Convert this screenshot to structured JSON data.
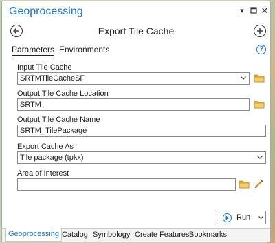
{
  "pane": {
    "title": "Geoprocessing"
  },
  "tool": {
    "title": "Export Tile Cache"
  },
  "tabs": {
    "parameters": "Parameters",
    "environments": "Environments"
  },
  "help": {
    "glyph": "?"
  },
  "fields": [
    {
      "label": "Input Tile Cache",
      "value": "SRTMTileCacheSF"
    },
    {
      "label": "Output Tile Cache Location",
      "value": "SRTM"
    },
    {
      "label": "Output Tile Cache Name",
      "value": "SRTM_TilePackage"
    },
    {
      "label": "Export Cache As",
      "value": "Tile package (tpkx)"
    },
    {
      "label": "Area of Interest",
      "value": ""
    }
  ],
  "run": {
    "label": "Run"
  },
  "bottom_tabs": [
    "Geoprocessing",
    "Catalog",
    "Symbology",
    "Create Features",
    "Bookmarks"
  ],
  "colors": {
    "accent": "#1f77c4",
    "folder": "#e8b64a"
  }
}
